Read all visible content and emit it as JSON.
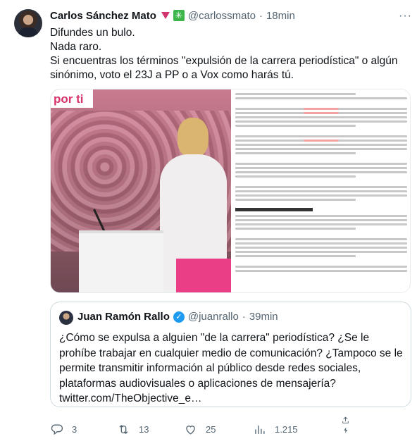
{
  "tweet": {
    "author_name": "Carlos Sánchez Mato",
    "handle": "@carlossmato",
    "separator": "·",
    "time": "18min",
    "more_label": "···",
    "lines": [
      "Difundes un bulo.",
      "Nada raro.",
      "Si encuentras los términos \"expulsión de la carrera periodística\" o algún sinónimo, voto el 23J a PP o a Vox como harás tú."
    ],
    "media": {
      "photo_caption": "por ti"
    }
  },
  "quote": {
    "author_name": "Juan Ramón Rallo",
    "verified_icon": "✓",
    "handle": "@juanrallo",
    "separator": "·",
    "time": "39min",
    "text": "¿Cómo se expulsa a alguien \"de la carrera\" periodística? ¿Se le prohíbe trabajar en cualquier medio de comunicación? ¿Tampoco se le permite transmitir información al público desde redes sociales, plataformas audiovisuales o aplicaciones de mensajería? twitter.com/TheObjective_e…"
  },
  "actions": {
    "replies": "3",
    "retweets": "13",
    "likes": "25",
    "views": "1.215"
  },
  "colors": {
    "text": "#0f1419",
    "secondary": "#536471",
    "accent": "#1d9bf0",
    "flag": "#d1346f",
    "party_badge": "#3cb54a"
  }
}
